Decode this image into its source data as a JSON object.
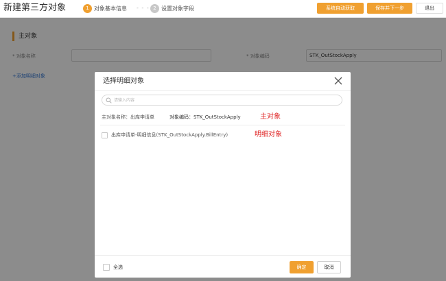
{
  "header": {
    "title": "新建第三方对象",
    "steps": [
      {
        "num": "1",
        "label": "对象基本信息"
      },
      {
        "num": "2",
        "label": "设置对象字段"
      }
    ],
    "step_separator": "- - -",
    "buttons": {
      "auto_fetch": "系统自动获取",
      "save_next": "保存并下一步",
      "exit": "退出"
    }
  },
  "form": {
    "section_title": "主对象",
    "name_label": "* 对象名称",
    "name_value": "",
    "code_label": "* 对象编码",
    "code_value": "STK_OutStockApply",
    "add_detail_link": "+添加明细对象"
  },
  "modal": {
    "title": "选择明细对象",
    "search_placeholder": "请输入内容",
    "main_object_name": "主对象名称：出库申请单",
    "main_object_code": "对象编码：STK_OutStockApply",
    "annotation_main": "主对象",
    "detail_items": [
      {
        "label": "出库申请单-明细信息(STK_OutStockApply.BillEntry)",
        "checked": false
      }
    ],
    "annotation_detail": "明细对象",
    "select_all_label": "全选",
    "confirm_label": "确定",
    "cancel_label": "取消"
  },
  "colors": {
    "accent": "#f0a030",
    "annotation": "#e02a2a",
    "link": "#3a7bd5",
    "overlay": "rgba(0,0,0,0.45)"
  }
}
